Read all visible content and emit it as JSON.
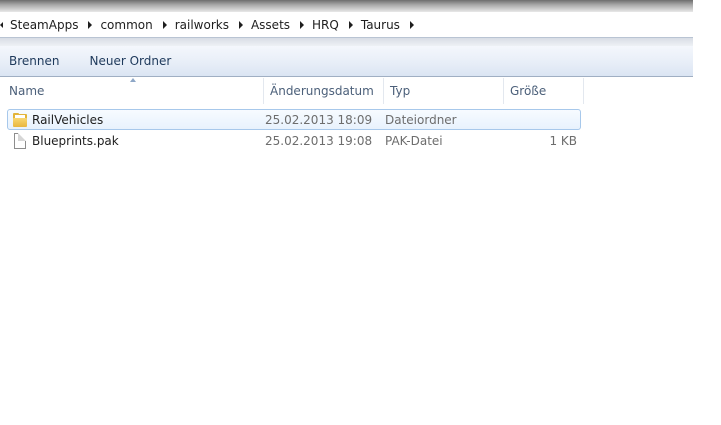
{
  "address_bar": {
    "breadcrumbs": [
      "SteamApps",
      "common",
      "railworks",
      "Assets",
      "HRQ",
      "Taurus"
    ]
  },
  "command_bar": {
    "burn_label": "Brennen",
    "new_folder_label": "Neuer Ordner"
  },
  "columns": {
    "name": "Name",
    "date": "Änderungsdatum",
    "type": "Typ",
    "size": "Größe"
  },
  "files": [
    {
      "name": "RailVehicles",
      "date": "25.02.2013 18:09",
      "type": "Dateiordner",
      "size": "",
      "icon": "folder-icon",
      "selected": true
    },
    {
      "name": "Blueprints.pak",
      "date": "25.02.2013 19:08",
      "type": "PAK-Datei",
      "size": "1 KB",
      "icon": "file-icon",
      "selected": false
    }
  ],
  "colors": {
    "selection_border": "#a7c8eb",
    "command_bar_text": "#1e395b",
    "header_text": "#4c607a"
  }
}
